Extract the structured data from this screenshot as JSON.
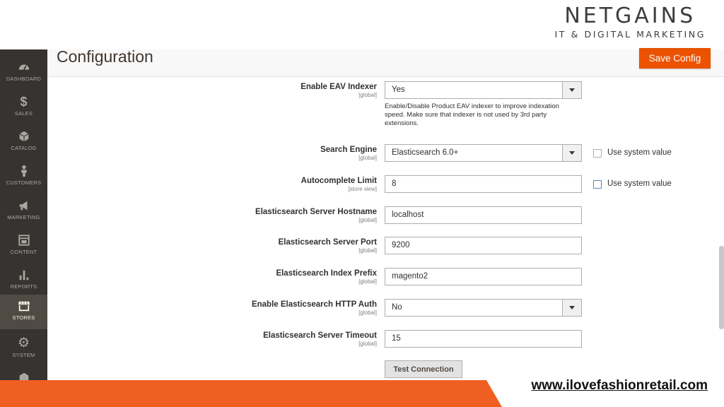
{
  "brand": {
    "name": "NETGAINS",
    "tagline": "IT & DIGITAL MARKETING"
  },
  "sidebar": {
    "items": [
      {
        "label": "DASHBOARD",
        "icon": "dashboard-icon"
      },
      {
        "label": "SALES",
        "icon": "dollar-icon"
      },
      {
        "label": "CATALOG",
        "icon": "cube-icon"
      },
      {
        "label": "CUSTOMERS",
        "icon": "person-icon"
      },
      {
        "label": "MARKETING",
        "icon": "megaphone-icon"
      },
      {
        "label": "CONTENT",
        "icon": "layout-icon"
      },
      {
        "label": "REPORTS",
        "icon": "bar-chart-icon"
      },
      {
        "label": "STORES",
        "icon": "storefront-icon",
        "active": true
      },
      {
        "label": "SYSTEM",
        "icon": "gear-icon"
      },
      {
        "label": "",
        "icon": "box-icon"
      }
    ]
  },
  "page": {
    "title": "Configuration",
    "save_label": "Save Config"
  },
  "fields": [
    {
      "label": "Enable EAV Indexer",
      "scope": "[global]",
      "type": "select",
      "value": "Yes",
      "hint": "Enable/Disable Product EAV indexer to improve indexation speed. Make sure that indexer is not used by 3rd party extensions."
    },
    {
      "label": "Search Engine",
      "scope": "[global]",
      "type": "select",
      "value": "Elasticsearch 6.0+",
      "system_value": "Use system value"
    },
    {
      "label": "Autocomplete Limit",
      "scope": "[store view]",
      "type": "text",
      "value": "8",
      "system_value": "Use system value"
    },
    {
      "label": "Elasticsearch Server Hostname",
      "scope": "[global]",
      "type": "text",
      "value": "localhost"
    },
    {
      "label": "Elasticsearch Server Port",
      "scope": "[global]",
      "type": "text",
      "value": "9200"
    },
    {
      "label": "Elasticsearch Index Prefix",
      "scope": "[global]",
      "type": "text",
      "value": "magento2"
    },
    {
      "label": "Enable Elasticsearch HTTP Auth",
      "scope": "[global]",
      "type": "select",
      "value": "No"
    },
    {
      "label": "Elasticsearch Server Timeout",
      "scope": "[global]",
      "type": "text",
      "value": "15"
    }
  ],
  "test_connection_label": "Test Connection",
  "footer": {
    "url": "www.ilovefashionretail.com"
  },
  "colors": {
    "accent": "#eb5202",
    "sidebar": "#373330",
    "footer": "#ef5f22"
  }
}
